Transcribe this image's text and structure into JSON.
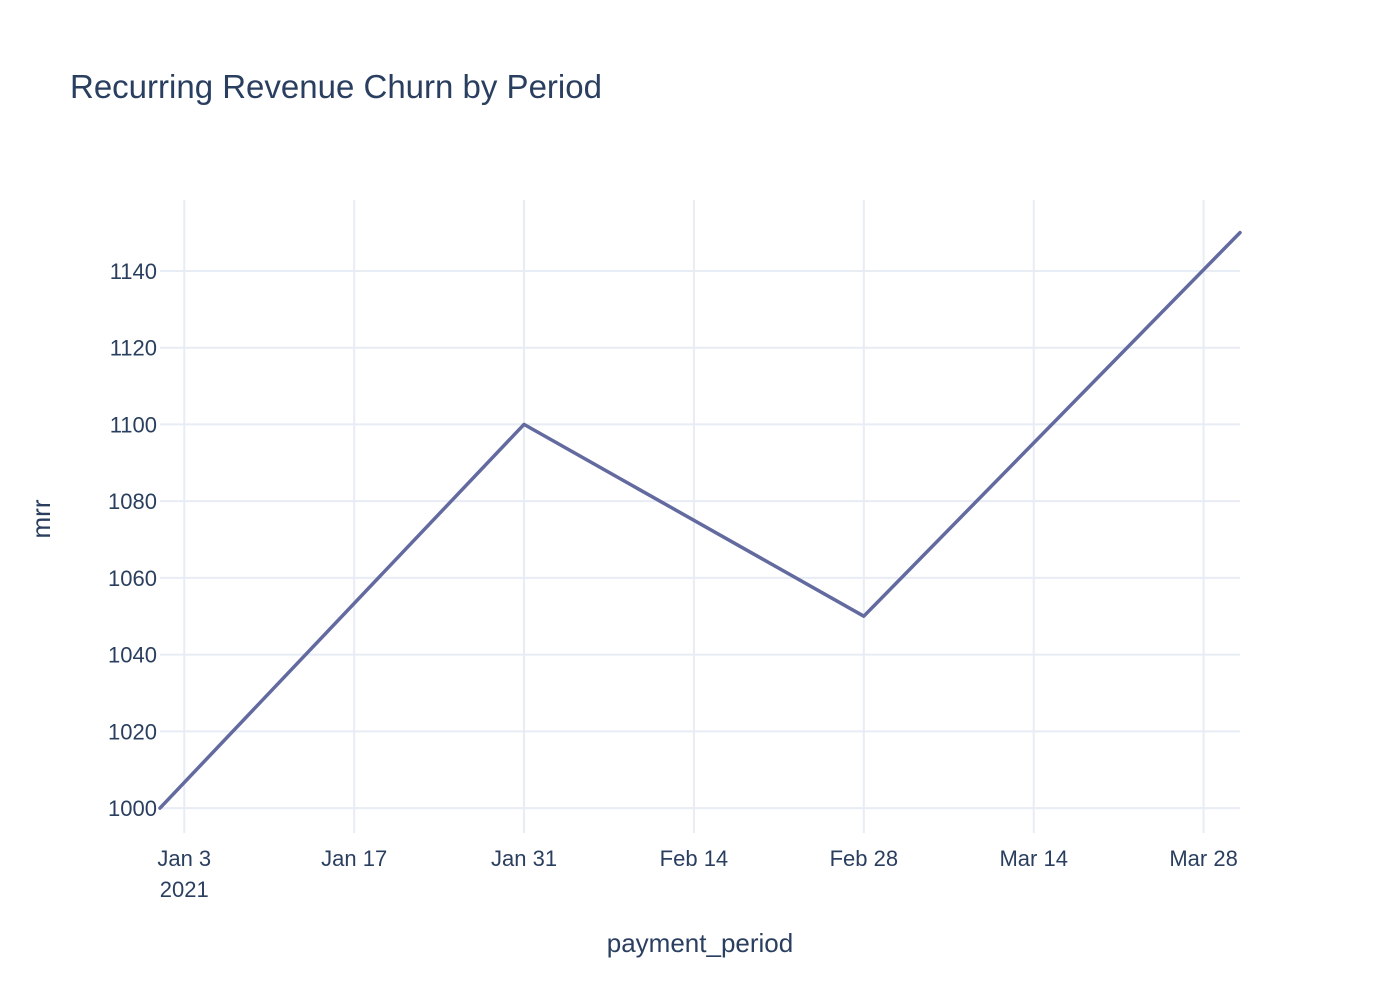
{
  "chart_data": {
    "type": "line",
    "title": "Recurring Revenue Churn by Period",
    "xlabel": "payment_period",
    "ylabel": "mrr",
    "x_dates": [
      "2021-01-01",
      "2021-01-31",
      "2021-02-28",
      "2021-03-31"
    ],
    "series": [
      {
        "values": [
          1000,
          1100,
          1050,
          1150
        ],
        "color": "#636a9f"
      }
    ],
    "xlim": [
      "2021-01-01",
      "2021-03-31"
    ],
    "ylim": [
      993.5,
      1158.5
    ],
    "x_ticks": [
      {
        "date": "2021-01-03",
        "label": "Jan 3",
        "sub": "2021"
      },
      {
        "date": "2021-01-17",
        "label": "Jan 17"
      },
      {
        "date": "2021-01-31",
        "label": "Jan 31"
      },
      {
        "date": "2021-02-14",
        "label": "Feb 14"
      },
      {
        "date": "2021-02-28",
        "label": "Feb 28"
      },
      {
        "date": "2021-03-14",
        "label": "Mar 14"
      },
      {
        "date": "2021-03-28",
        "label": "Mar 28"
      }
    ],
    "y_ticks": [
      1000,
      1020,
      1040,
      1060,
      1080,
      1100,
      1120,
      1140
    ],
    "grid": true,
    "colors": {
      "grid": "#e8ecf4",
      "text": "#2a3f5f",
      "background": "#ffffff"
    }
  }
}
